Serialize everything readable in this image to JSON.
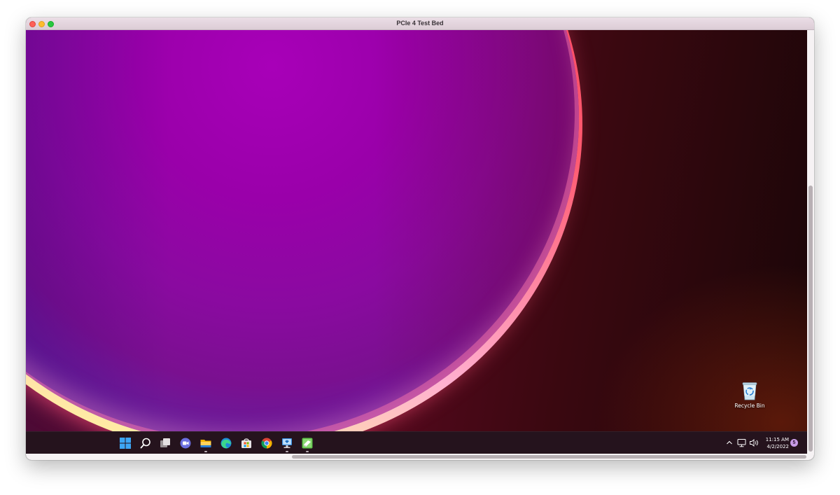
{
  "window": {
    "title": "PCIe 4 Test Bed",
    "controls": [
      "close",
      "minimize",
      "zoom"
    ]
  },
  "desktop": {
    "icons": [
      {
        "label": "Recycle Bin",
        "icon": "recycle-bin-icon"
      }
    ]
  },
  "taskbar": {
    "apps": [
      {
        "name": "start",
        "icon": "windows-start-icon",
        "running": false
      },
      {
        "name": "search",
        "icon": "search-icon",
        "running": false
      },
      {
        "name": "task-view",
        "icon": "task-view-icon",
        "running": false
      },
      {
        "name": "chat",
        "icon": "teams-chat-icon",
        "running": false
      },
      {
        "name": "file-explorer",
        "icon": "folder-icon",
        "running": true
      },
      {
        "name": "edge",
        "icon": "edge-icon",
        "running": false
      },
      {
        "name": "store",
        "icon": "store-icon",
        "running": false
      },
      {
        "name": "chrome",
        "icon": "chrome-icon",
        "running": false
      },
      {
        "name": "remote-desktop",
        "icon": "remote-desktop-icon",
        "running": true
      },
      {
        "name": "app",
        "icon": "green-app-icon",
        "running": true
      }
    ],
    "tray": {
      "time": "11:15 AM",
      "date": "4/2/2022",
      "notifications": "5"
    }
  },
  "colors": {
    "taskbar_bg": "#26141e",
    "accent_notification": "#c89ce6"
  }
}
